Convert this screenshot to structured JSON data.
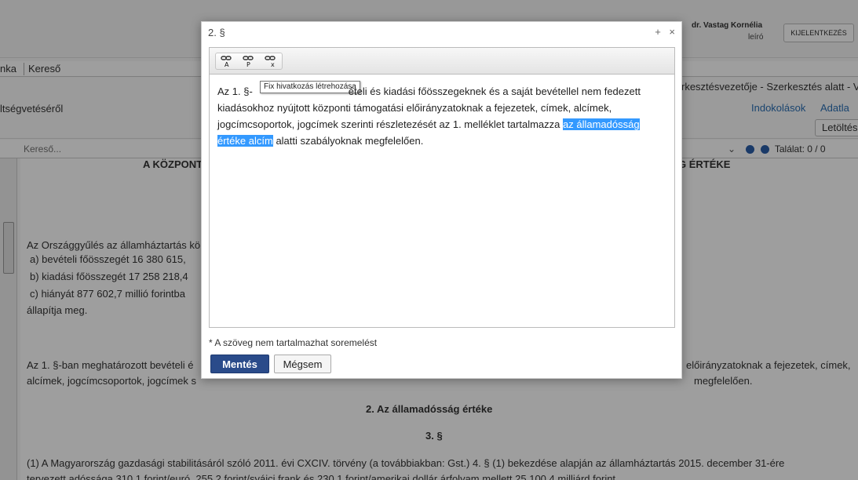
{
  "header": {
    "user_name": "dr. Vastag Kornélia",
    "user_role": "leíró",
    "logout_label": "KIJELENTKEZÉS"
  },
  "menu": {
    "items": [
      {
        "label": "nka"
      },
      {
        "label": "Kereső"
      }
    ]
  },
  "document": {
    "title_fragment": "ltségvetéséről",
    "status_text": "rkesztésvezetője - Szerkesztés alatt - V",
    "links": [
      {
        "label": "Indokolások"
      },
      {
        "label": "Adatla"
      }
    ],
    "download_label": "Letöltés"
  },
  "search": {
    "placeholder": "Kereső...",
    "result_text": "Találat: 0 / 0"
  },
  "content": {
    "heading_left": "A KÖZPONT",
    "heading_right": "G ÉRTÉKE",
    "para1": "Az Országgyűlés az államháztartás kö",
    "line_a": "a) bevételi főösszegét 16 380 615,",
    "line_b": "b) kiadási főösszegét 17 258 218,4",
    "line_c": "c) hiányát 877 602,7 millió forintba",
    "line_d": "állapítja meg.",
    "para2_left": "Az 1. §-ban meghatározott bevételi é",
    "para2_right": "előirányzatoknak a fejezetek, címek,",
    "para2_line2_left": "alcímek, jogcímcsoportok, jogcímek s",
    "para2_line2_right": "megfelelően.",
    "section_title": "2. Az államadósság értéke",
    "section_number": "3. §",
    "para3": "(1) A Magyarország gazdasági stabilitásáról szóló 2011. évi CXCIV. törvény (a továbbiakban: Gst.) 4. § (1) bekezdése alapján az államháztartás 2015. december 31-ére",
    "para3_line2": "tervezett adóssága 310,1 forint/euró, 255,2 forint/svájci frank és 230,1 forint/amerikai dollár árfolyam mellett 25 100,4 milliárd forint."
  },
  "modal": {
    "title": "2. §",
    "maximize_icon": "+",
    "close_icon": "×",
    "tooltip": "Fix hivatkozás létrehozása",
    "editor_text_before": "Az 1. §-",
    "editor_text_line1_rest": "ételi és kiadási főösszegeknek és a saját bevétellel nem fedezett",
    "editor_text_line2": "kiadásokhoz nyújtott központi támogatási előirányzatoknak a fejezetek, címek, alcímek,",
    "editor_text_line3": "jogcímcsoportok, jogcímek szerinti részletezését az 1. melléklet tartalmazza",
    "editor_selected_1": "az államadósság",
    "editor_selected_2": "értéke alcím",
    "editor_text_after": "alatti szabályoknak megfelelően.",
    "note": "* A szöveg nem tartalmazhat soremelést",
    "save_label": "Mentés",
    "cancel_label": "Mégsem"
  },
  "colors": {
    "primary_button": "#2a4b8a",
    "selection": "#3399ff",
    "link": "#2a6fb4"
  }
}
